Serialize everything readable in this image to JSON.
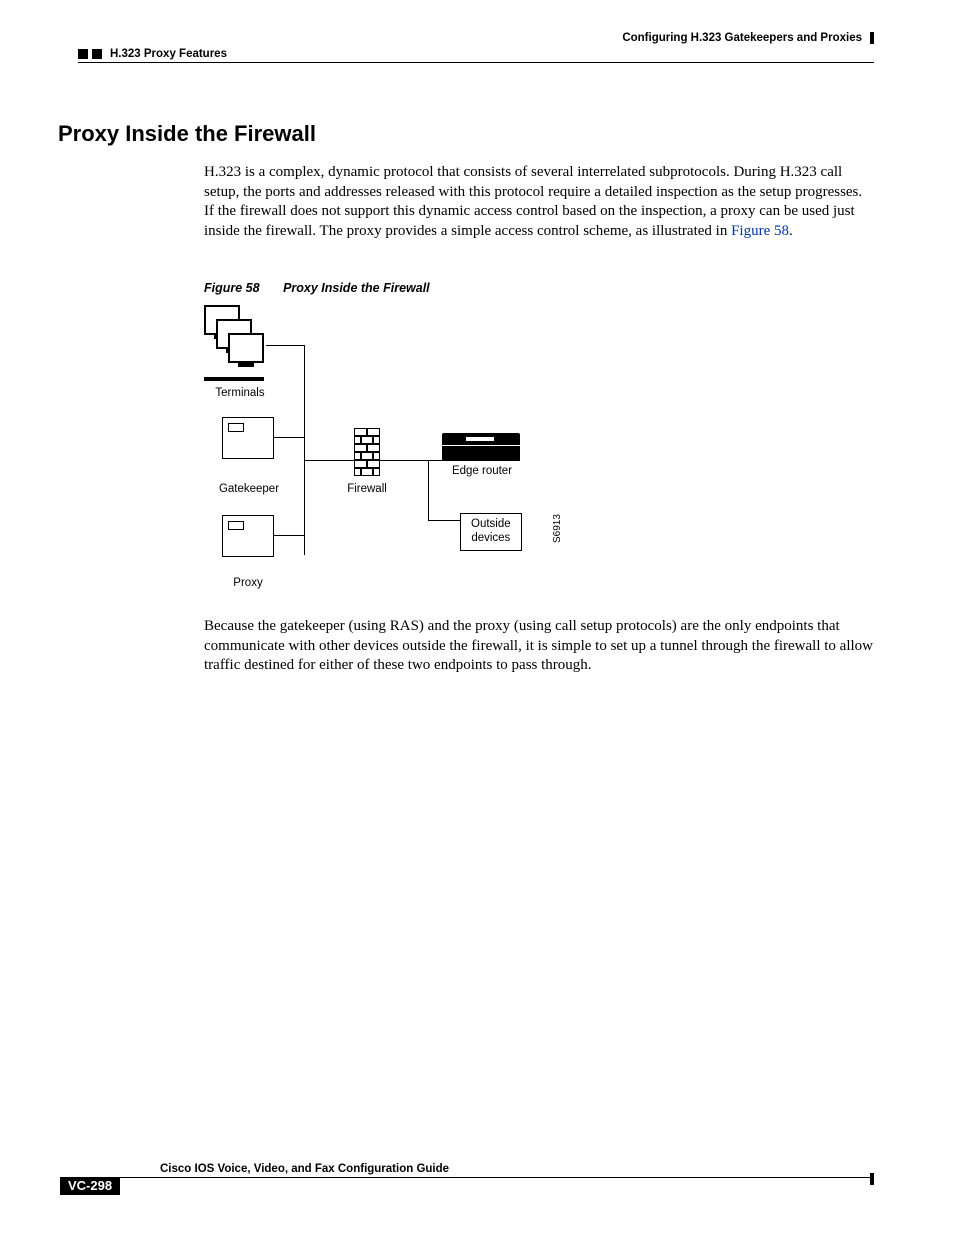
{
  "header": {
    "right": "Configuring H.323 Gatekeepers and Proxies",
    "left": "H.323 Proxy Features"
  },
  "heading": "Proxy Inside the Firewall",
  "para1_a": "H.323 is a complex, dynamic protocol that consists of several interrelated subprotocols. During H.323 call setup, the ports and addresses released with this protocol require a detailed inspection as the setup progresses. If the firewall does not support this dynamic access control based on the inspection, a proxy can be used just inside the firewall. The proxy provides a simple access control scheme, as illustrated in ",
  "para1_link": "Figure 58",
  "para1_b": ".",
  "figure": {
    "num": "Figure 58",
    "title": "Proxy Inside the Firewall",
    "labels": {
      "terminals": "Terminals",
      "gatekeeper": "Gatekeeper",
      "firewall": "Firewall",
      "edge_router": "Edge router",
      "proxy": "Proxy",
      "outside": "Outside\ndevices",
      "id": "S6913"
    }
  },
  "para2": "Because the gatekeeper (using RAS) and the proxy (using call setup protocols) are the only endpoints that communicate with other devices outside the firewall, it is simple to set up a tunnel through the firewall to allow traffic destined for either of these two endpoints to pass through.",
  "footer": {
    "book": "Cisco IOS Voice, Video, and Fax Configuration Guide",
    "page": "VC-298"
  }
}
